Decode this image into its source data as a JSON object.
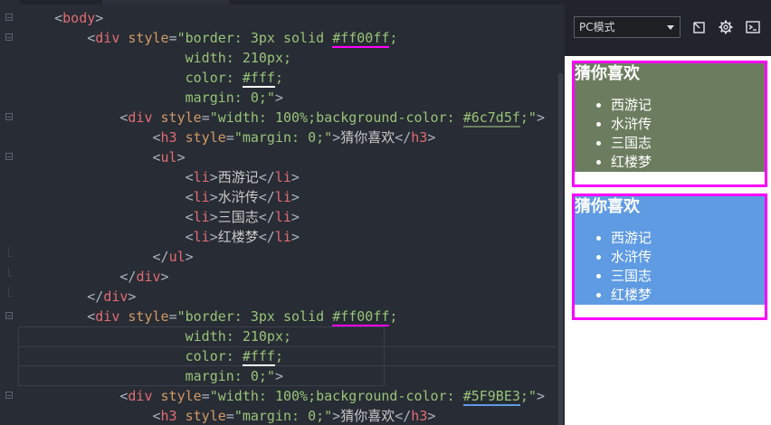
{
  "editor": {
    "lines": [
      {
        "segments": [
          {
            "c": "p",
            "v": "    <"
          },
          {
            "c": "t",
            "v": "body"
          },
          {
            "c": "p",
            "v": ">"
          }
        ]
      },
      {
        "segments": [
          {
            "c": "p",
            "v": "        <"
          },
          {
            "c": "t",
            "v": "div"
          },
          {
            "c": "p",
            "v": " "
          },
          {
            "c": "a",
            "v": "style"
          },
          {
            "c": "p",
            "v": "="
          },
          {
            "c": "s",
            "v": "\"border: 3px solid "
          },
          {
            "c": "s",
            "v": "#ff00ff",
            "hl": "#ff00ff"
          },
          {
            "c": "s",
            "v": ";"
          }
        ]
      },
      {
        "segments": [
          {
            "c": "s",
            "v": "                    width: 210px;"
          }
        ]
      },
      {
        "segments": [
          {
            "c": "s",
            "v": "                    color: "
          },
          {
            "c": "s",
            "v": "#fff",
            "hl": "#ffffff"
          },
          {
            "c": "s",
            "v": ";"
          }
        ]
      },
      {
        "segments": [
          {
            "c": "s",
            "v": "                    margin: 0;\""
          },
          {
            "c": "p",
            "v": ">"
          }
        ]
      },
      {
        "segments": [
          {
            "c": "p",
            "v": "            <"
          },
          {
            "c": "t",
            "v": "div"
          },
          {
            "c": "p",
            "v": " "
          },
          {
            "c": "a",
            "v": "style"
          },
          {
            "c": "p",
            "v": "="
          },
          {
            "c": "s",
            "v": "\"width: 100%;background-color: "
          },
          {
            "c": "s",
            "v": "#6c7d5f",
            "hl": "#6c7d5f"
          },
          {
            "c": "s",
            "v": ";\""
          },
          {
            "c": "p",
            "v": ">"
          }
        ]
      },
      {
        "segments": [
          {
            "c": "p",
            "v": "                <"
          },
          {
            "c": "t",
            "v": "h3"
          },
          {
            "c": "p",
            "v": " "
          },
          {
            "c": "a",
            "v": "style"
          },
          {
            "c": "p",
            "v": "="
          },
          {
            "c": "s",
            "v": "\"margin: 0;\""
          },
          {
            "c": "p",
            "v": ">"
          },
          {
            "c": "x",
            "v": "猜你喜欢"
          },
          {
            "c": "p",
            "v": "</"
          },
          {
            "c": "t",
            "v": "h3"
          },
          {
            "c": "p",
            "v": ">"
          }
        ]
      },
      {
        "segments": [
          {
            "c": "p",
            "v": "                <"
          },
          {
            "c": "t",
            "v": "ul"
          },
          {
            "c": "p",
            "v": ">"
          }
        ]
      },
      {
        "segments": [
          {
            "c": "p",
            "v": "                    <"
          },
          {
            "c": "t",
            "v": "li"
          },
          {
            "c": "p",
            "v": ">"
          },
          {
            "c": "x",
            "v": "西游记"
          },
          {
            "c": "p",
            "v": "</"
          },
          {
            "c": "t",
            "v": "li"
          },
          {
            "c": "p",
            "v": ">"
          }
        ]
      },
      {
        "segments": [
          {
            "c": "p",
            "v": "                    <"
          },
          {
            "c": "t",
            "v": "li"
          },
          {
            "c": "p",
            "v": ">"
          },
          {
            "c": "x",
            "v": "水浒传"
          },
          {
            "c": "p",
            "v": "</"
          },
          {
            "c": "t",
            "v": "li"
          },
          {
            "c": "p",
            "v": ">"
          }
        ]
      },
      {
        "segments": [
          {
            "c": "p",
            "v": "                    <"
          },
          {
            "c": "t",
            "v": "li"
          },
          {
            "c": "p",
            "v": ">"
          },
          {
            "c": "x",
            "v": "三国志"
          },
          {
            "c": "p",
            "v": "</"
          },
          {
            "c": "t",
            "v": "li"
          },
          {
            "c": "p",
            "v": ">"
          }
        ]
      },
      {
        "segments": [
          {
            "c": "p",
            "v": "                    <"
          },
          {
            "c": "t",
            "v": "li"
          },
          {
            "c": "p",
            "v": ">"
          },
          {
            "c": "x",
            "v": "红楼梦"
          },
          {
            "c": "p",
            "v": "</"
          },
          {
            "c": "t",
            "v": "li"
          },
          {
            "c": "p",
            "v": ">"
          }
        ]
      },
      {
        "segments": [
          {
            "c": "p",
            "v": "                </"
          },
          {
            "c": "t",
            "v": "ul"
          },
          {
            "c": "p",
            "v": ">"
          }
        ]
      },
      {
        "segments": [
          {
            "c": "p",
            "v": "            </"
          },
          {
            "c": "t",
            "v": "div"
          },
          {
            "c": "p",
            "v": ">"
          }
        ]
      },
      {
        "segments": [
          {
            "c": "p",
            "v": "        </"
          },
          {
            "c": "t",
            "v": "div"
          },
          {
            "c": "p",
            "v": ">"
          }
        ]
      },
      {
        "segments": [
          {
            "c": "p",
            "v": "        <"
          },
          {
            "c": "t",
            "v": "div"
          },
          {
            "c": "p",
            "v": " "
          },
          {
            "c": "a",
            "v": "style"
          },
          {
            "c": "p",
            "v": "="
          },
          {
            "c": "s",
            "v": "\"border: 3px solid "
          },
          {
            "c": "s",
            "v": "#ff00ff",
            "hl": "#ff00ff"
          },
          {
            "c": "s",
            "v": ";"
          }
        ]
      },
      {
        "segments": [
          {
            "c": "s",
            "v": "                    width: 210px;"
          }
        ]
      },
      {
        "segments": [
          {
            "c": "s",
            "v": "                    color: "
          },
          {
            "c": "s",
            "v": "#fff",
            "hl": "#ffffff"
          },
          {
            "c": "s",
            "v": ";"
          }
        ]
      },
      {
        "segments": [
          {
            "c": "s",
            "v": "                    margin: 0;\""
          },
          {
            "c": "p",
            "v": ">"
          }
        ]
      },
      {
        "segments": [
          {
            "c": "p",
            "v": "            <"
          },
          {
            "c": "t",
            "v": "div"
          },
          {
            "c": "p",
            "v": " "
          },
          {
            "c": "a",
            "v": "style"
          },
          {
            "c": "p",
            "v": "="
          },
          {
            "c": "s",
            "v": "\"width: 100%;background-color: "
          },
          {
            "c": "s",
            "v": "#5F9BE3",
            "hl": "#5f9be3"
          },
          {
            "c": "s",
            "v": ";\""
          },
          {
            "c": "p",
            "v": ">"
          }
        ]
      },
      {
        "segments": [
          {
            "c": "p",
            "v": "                <"
          },
          {
            "c": "t",
            "v": "h3"
          },
          {
            "c": "p",
            "v": " "
          },
          {
            "c": "a",
            "v": "style"
          },
          {
            "c": "p",
            "v": "="
          },
          {
            "c": "s",
            "v": "\"margin: 0;\""
          },
          {
            "c": "p",
            "v": ">"
          },
          {
            "c": "x",
            "v": "猜你喜欢"
          },
          {
            "c": "p",
            "v": "</"
          },
          {
            "c": "t",
            "v": "h3"
          },
          {
            "c": "p",
            "v": ">"
          }
        ]
      }
    ]
  },
  "preview": {
    "mode_select": "PC模式",
    "toolbar_icons": [
      "open-external-icon",
      "gear-icon",
      "terminal-icon"
    ],
    "boxes": [
      {
        "bg": "#6c7d5f",
        "title": "猜你喜欢",
        "items": [
          "西游记",
          "水浒传",
          "三国志",
          "红楼梦"
        ]
      },
      {
        "bg": "#5F9BE3",
        "title": "猜你喜欢",
        "items": [
          "西游记",
          "水浒传",
          "三国志",
          "红楼梦"
        ]
      }
    ]
  },
  "colors": {
    "editor_bg": "#282c34",
    "tag": "#e06c75",
    "attribute": "#d19a66",
    "string": "#98c379",
    "border": "#ff00ff"
  }
}
